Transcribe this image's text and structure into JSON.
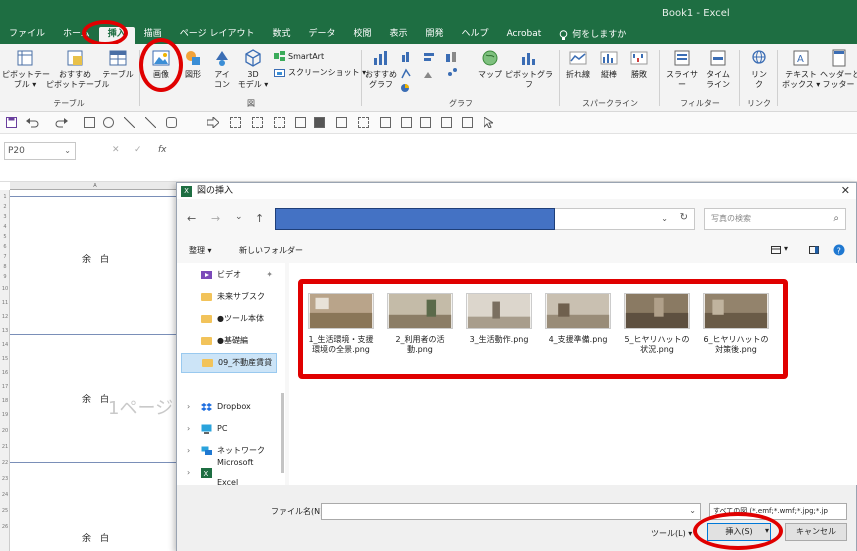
{
  "window": {
    "title": "Book1 - Excel"
  },
  "menu": {
    "items": [
      "ファイル",
      "ホーム",
      "挿入",
      "描画",
      "ページ レイアウト",
      "数式",
      "データ",
      "校閲",
      "表示",
      "開発",
      "ヘルプ",
      "Acrobat"
    ],
    "active_index": 2,
    "search_label": "何をしますか"
  },
  "ribbon": {
    "groups": {
      "table": {
        "label": "テーブル",
        "pivot": "ピボットテー\nブル ▾",
        "recommended_pivot": "おすすめ\nピボットテーブル",
        "table": "テーブル"
      },
      "illustration": {
        "label": "図",
        "picture": "画像",
        "shapes": "図形",
        "icons": "アイ\nコン",
        "models3d": "3D\nモデル ▾",
        "smartart": "SmartArt",
        "screenshot": "スクリーンショット ▾"
      },
      "chart": {
        "label": "グラフ",
        "recommended": "おすすめ\nグラフ",
        "map": "マップ",
        "pivot_chart": "ピボットグラフ"
      },
      "sparkline": {
        "label": "スパークライン",
        "line": "折れ線",
        "column": "縦棒",
        "winloss": "勝敗"
      },
      "filter": {
        "label": "フィルター",
        "slicer": "スライサー",
        "timeline": "タイム\nライン"
      },
      "link": {
        "label": "リンク",
        "link": "リン\nク"
      },
      "text": {
        "textbox": "テキスト\nボックス ▾",
        "header_footer": "ヘッダーと\nフッター"
      }
    }
  },
  "formula_bar": {
    "name_box": "P20",
    "cancel": "✕",
    "enter": "✓",
    "fx": "fx"
  },
  "sheet": {
    "column_label": "A",
    "cell_text": "余　白",
    "page_watermark": "1ページ"
  },
  "dialog": {
    "title": "図の挿入",
    "search_placeholder": "写真の検索",
    "organize": "整理 ▾",
    "new_folder": "新しいフォルダー",
    "nav_items": [
      {
        "label": "ビデオ",
        "kind": "video"
      },
      {
        "label": "未来サブスク",
        "kind": "folder"
      },
      {
        "label": "●ツール本体",
        "kind": "folder"
      },
      {
        "label": "●基礎編",
        "kind": "folder"
      },
      {
        "label": "09_不動産賃貸",
        "kind": "folder",
        "selected": true
      },
      {
        "label": "Dropbox",
        "kind": "dropbox"
      },
      {
        "label": "PC",
        "kind": "pc"
      },
      {
        "label": "ネットワーク",
        "kind": "network"
      },
      {
        "label": "Microsoft Excel",
        "kind": "excel"
      }
    ],
    "files": [
      {
        "name": "1_生活環境・支援環境の全景.png",
        "color": "#b9a48a"
      },
      {
        "name": "2_利用者の活動.png",
        "color": "#9d8f7a"
      },
      {
        "name": "3_生活動作.png",
        "color": "#c9c2b6"
      },
      {
        "name": "4_支援準備.png",
        "color": "#a8a093"
      },
      {
        "name": "5_ヒヤリハットの状況.png",
        "color": "#8a7a63"
      },
      {
        "name": "6_ヒヤリハットの対策後.png",
        "color": "#93836c"
      }
    ],
    "filename_label": "ファイル名(N):",
    "filename_value": "",
    "filetype": "すべての図 (*.emf;*.wmf;*.jpg;*.jp",
    "tools": "ツール(L) ▾",
    "insert": "挿入(S)",
    "cancel": "キャンセル"
  },
  "colors": {
    "excel_green": "#1e6e42",
    "highlight_red": "#e00000",
    "address_blue": "#4472c4"
  }
}
